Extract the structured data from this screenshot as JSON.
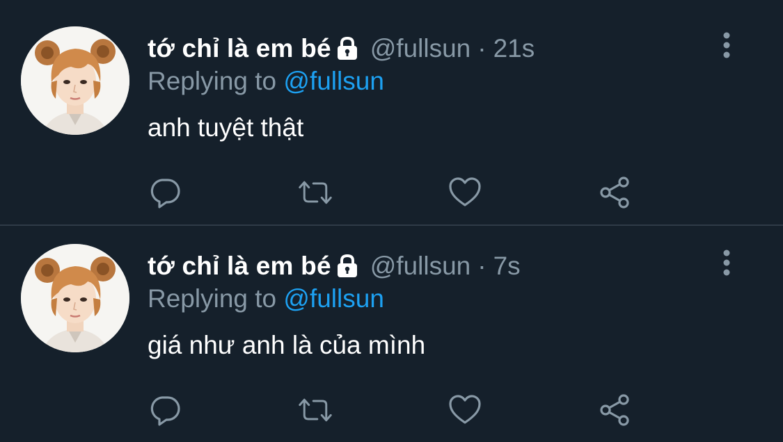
{
  "theme": {
    "background": "#15202b",
    "name_color": "#ffffff",
    "meta_color": "#8899a6",
    "mention_color": "#1da1f2",
    "divider_color": "#2f3b47"
  },
  "tweets": [
    {
      "display_name": "tớ chỉ là em bé",
      "handle": "@fullsun",
      "separator": "·",
      "time": "21s",
      "replying_prefix": "Replying to",
      "replying_to": "@fullsun",
      "text": "anh tuyệt thật",
      "icons": [
        "lock-icon",
        "more-icon",
        "reply-icon",
        "retweet-icon",
        "like-icon",
        "share-icon"
      ]
    },
    {
      "display_name": "tớ chỉ là em bé",
      "handle": "@fullsun",
      "separator": "·",
      "time": "7s",
      "replying_prefix": "Replying to",
      "replying_to": "@fullsun",
      "text": "giá như anh là của mình",
      "icons": [
        "lock-icon",
        "more-icon",
        "reply-icon",
        "retweet-icon",
        "like-icon",
        "share-icon"
      ]
    }
  ]
}
